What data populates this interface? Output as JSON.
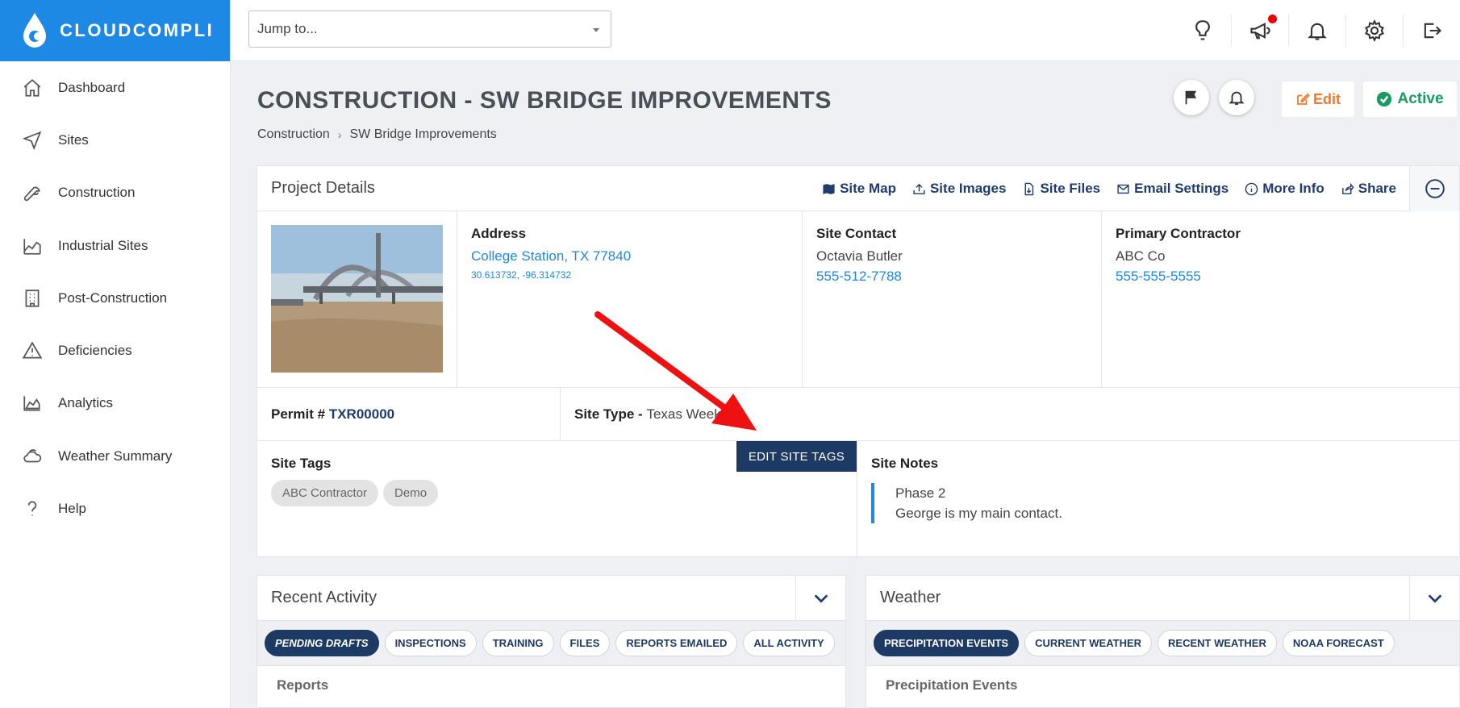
{
  "app": {
    "name": "CLOUDCOMPLI"
  },
  "sidebar": {
    "items": [
      {
        "label": "Dashboard",
        "icon": "home-icon"
      },
      {
        "label": "Sites",
        "icon": "navigation-icon"
      },
      {
        "label": "Construction",
        "icon": "wrench-icon"
      },
      {
        "label": "Industrial Sites",
        "icon": "factory-icon"
      },
      {
        "label": "Post-Construction",
        "icon": "building-icon"
      },
      {
        "label": "Deficiencies",
        "icon": "warning-icon"
      },
      {
        "label": "Analytics",
        "icon": "area-chart-icon"
      },
      {
        "label": "Weather Summary",
        "icon": "cloud-icon"
      },
      {
        "label": "Help",
        "icon": "question-icon"
      }
    ]
  },
  "topbar": {
    "jump_placeholder": "Jump to..."
  },
  "page": {
    "title": "CONSTRUCTION - SW BRIDGE IMPROVEMENTS",
    "breadcrumb": [
      "Construction",
      "SW Bridge Improvements"
    ],
    "edit_label": "Edit",
    "status_label": "Active"
  },
  "project": {
    "header": "Project Details",
    "links": [
      "Site Map",
      "Site Images",
      "Site Files",
      "Email Settings",
      "More Info",
      "Share"
    ],
    "address": {
      "heading": "Address",
      "city": "College Station, TX 77840",
      "coords": "30.613732, -96.314732"
    },
    "contact": {
      "heading": "Site Contact",
      "name": "Octavia Butler",
      "phone": "555-512-7788"
    },
    "contractor": {
      "heading": "Primary Contractor",
      "name": "ABC Co",
      "phone": "555-555-5555"
    },
    "permit": {
      "label": "Permit #",
      "value": "TXR00000"
    },
    "site_type": {
      "label": "Site Type -",
      "value": "Texas Week"
    },
    "tags": {
      "heading": "Site Tags",
      "items": [
        "ABC Contractor",
        "Demo"
      ],
      "edit_label": "EDIT SITE TAGS"
    },
    "notes": {
      "heading": "Site Notes",
      "lines": [
        "Phase 2",
        "George is my main contact."
      ]
    }
  },
  "recent_activity": {
    "title": "Recent Activity",
    "tabs": [
      "PENDING DRAFTS",
      "INSPECTIONS",
      "TRAINING",
      "FILES",
      "REPORTS EMAILED",
      "ALL ACTIVITY"
    ],
    "section": "Reports"
  },
  "weather": {
    "title": "Weather",
    "tabs": [
      "PRECIPITATION EVENTS",
      "CURRENT WEATHER",
      "RECENT WEATHER",
      "NOAA FORECAST"
    ],
    "section": "Precipitation Events"
  },
  "colors": {
    "brand": "#1e88e5",
    "navy": "#1c3a64",
    "edit": "#f07a2a",
    "active": "#1a9b62",
    "annotation": "#ee1111"
  }
}
